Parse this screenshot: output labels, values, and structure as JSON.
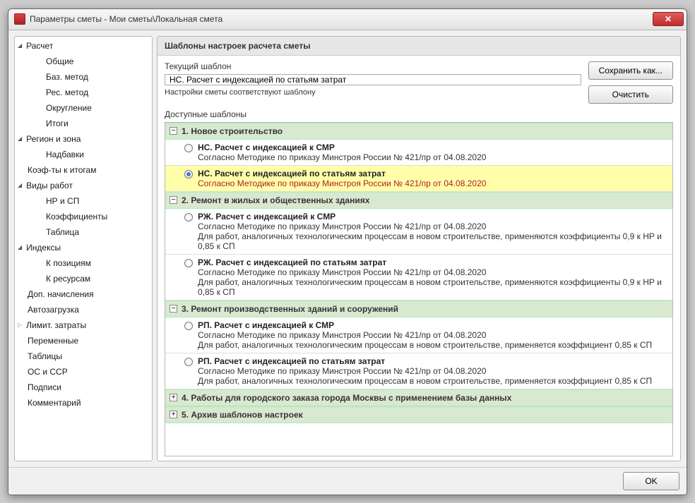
{
  "window": {
    "title": "Параметры сметы - Мои сметы\\Локальная смета"
  },
  "sidebar": {
    "items": [
      {
        "label": "Расчет",
        "type": "expander"
      },
      {
        "label": "Общие",
        "type": "child"
      },
      {
        "label": "Баз. метод",
        "type": "child"
      },
      {
        "label": "Рес. метод",
        "type": "child"
      },
      {
        "label": "Округление",
        "type": "child"
      },
      {
        "label": "Итоги",
        "type": "child"
      },
      {
        "label": "Регион и зона",
        "type": "expander"
      },
      {
        "label": "Надбавки",
        "type": "child"
      },
      {
        "label": "Коэф-ты к итогам",
        "type": "plain"
      },
      {
        "label": "Виды работ",
        "type": "expander"
      },
      {
        "label": "НР и СП",
        "type": "child"
      },
      {
        "label": "Коэффициенты",
        "type": "child"
      },
      {
        "label": "Таблица",
        "type": "child"
      },
      {
        "label": "Индексы",
        "type": "expander"
      },
      {
        "label": "К позициям",
        "type": "child"
      },
      {
        "label": "К ресурсам",
        "type": "child"
      },
      {
        "label": "Доп. начисления",
        "type": "plain"
      },
      {
        "label": "Автозагрузка",
        "type": "plain"
      },
      {
        "label": "Лимит. затраты",
        "type": "expander-collapsed"
      },
      {
        "label": "Переменные",
        "type": "plain"
      },
      {
        "label": "Таблицы",
        "type": "plain"
      },
      {
        "label": "ОС и ССР",
        "type": "plain"
      },
      {
        "label": "Подписи",
        "type": "plain"
      },
      {
        "label": "Комментарий",
        "type": "plain"
      }
    ]
  },
  "main": {
    "section_title": "Шаблоны настроек расчета сметы",
    "current_label": "Текущий шаблон",
    "current_value": "НС. Расчет с индексацией по статьям затрат",
    "note": "Настройки сметы соответствуют шаблону",
    "available_label": "Доступные шаблоны",
    "save_as": "Сохранить как...",
    "clear": "Очистить"
  },
  "groups": [
    {
      "title": "1. Новое строительство",
      "expanded": true,
      "items": [
        {
          "title": "НС. Расчет с индексацией к СМР",
          "desc": "Согласно Методике по приказу Минстроя России № 421/пр от 04.08.2020",
          "selected": false
        },
        {
          "title": "НС. Расчет с индексацией по статьям затрат",
          "desc": "Согласно Методике по приказу Минстроя России № 421/пр от 04.08.2020",
          "selected": true
        }
      ]
    },
    {
      "title": "2. Ремонт в жилых и общественных зданиях",
      "expanded": true,
      "items": [
        {
          "title": "РЖ. Расчет с индексацией к СМР",
          "desc": "Согласно Методике по приказу Минстроя России № 421/пр от 04.08.2020\nДля работ, аналогичных технологическим процессам в новом строительстве, применяются коэффициенты 0,9 к НР и 0,85 к СП",
          "selected": false
        },
        {
          "title": "РЖ. Расчет с индексацией по статьям затрат",
          "desc": "Согласно Методике по приказу Минстроя России № 421/пр от 04.08.2020\nДля работ, аналогичных технологическим процессам в новом строительстве, применяются коэффициенты 0,9 к НР и 0,85 к СП",
          "selected": false
        }
      ]
    },
    {
      "title": "3. Ремонт производственных зданий и сооружений",
      "expanded": true,
      "items": [
        {
          "title": "РП. Расчет с индексацией к СМР",
          "desc": "Согласно Методике по приказу Минстроя России № 421/пр от 04.08.2020\nДля работ, аналогичных технологическим процессам в новом строительстве, применяется коэффициент 0,85 к СП",
          "selected": false
        },
        {
          "title": "РП. Расчет с индексацией по статьям затрат",
          "desc": "Согласно Методике по приказу Минстроя России № 421/пр от 04.08.2020\nДля работ, аналогичных технологическим процессам в новом строительстве, применяется коэффициент 0,85 к СП",
          "selected": false
        }
      ]
    },
    {
      "title": "4. Работы для городского заказа города Москвы с применением базы данных",
      "expanded": false,
      "items": []
    },
    {
      "title": "5. Архив шаблонов настроек",
      "expanded": false,
      "items": []
    }
  ],
  "footer": {
    "ok": "OK"
  }
}
